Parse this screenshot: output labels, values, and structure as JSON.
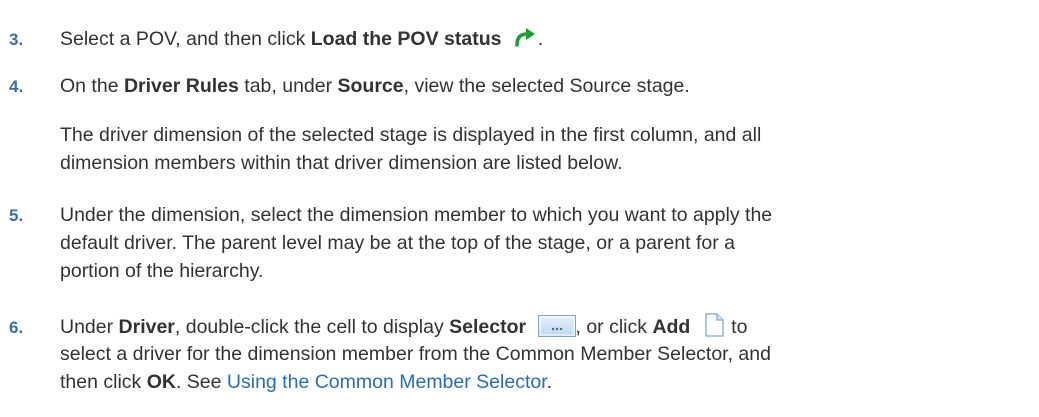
{
  "steps": [
    {
      "number": "3.",
      "lines": [
        {
          "pre": "Select a POV, and then click ",
          "bold": "Load the POV status",
          "post": "."
        }
      ],
      "icon": "green-curved-arrow-icon"
    },
    {
      "number": "4.",
      "lines": [
        {
          "pre": "On the ",
          "bold1": "Driver Rules",
          "mid": " tab, under ",
          "bold2": "Source",
          "post": ", view the selected Source stage."
        }
      ]
    },
    {
      "paragraph": [
        "The driver dimension of the selected stage is displayed in the first column, and all",
        "dimension members within that driver dimension are listed below."
      ]
    },
    {
      "number": "5.",
      "lines": [
        "Under the dimension, select the dimension member to which you want to apply the",
        "default driver. The parent level may be at the top of the stage, or a parent for a",
        "portion of the hierarchy."
      ]
    },
    {
      "number": "6.",
      "line1": {
        "pre": "Under ",
        "bold1": "Driver",
        "mid": ", double-click the cell to display ",
        "bold2": "Selector",
        "mid2": ", or click ",
        "bold3": "Add",
        "post": " to"
      },
      "line2": "select a driver for the dimension member from the Common Member Selector, and",
      "line3": {
        "pre": "then click ",
        "bold": "OK",
        "mid": ". See ",
        "link": "Using the Common Member Selector",
        "post": "."
      }
    }
  ],
  "icons": {
    "load_pov": "green-curved-arrow-icon",
    "selector": "ellipsis-button-icon",
    "add": "blank-page-icon"
  },
  "colors": {
    "step_number": "#3a6ea5",
    "link": "#2a6db5",
    "text": "#333333",
    "arrow": "#1f9a3a"
  }
}
